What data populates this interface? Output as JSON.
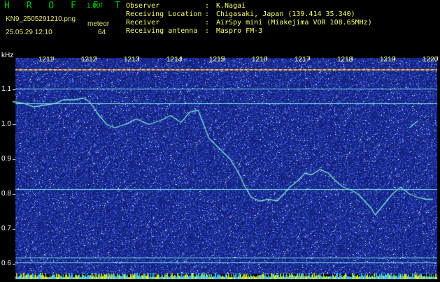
{
  "header": {
    "app_title": "H R O F F T",
    "version": "1.00f",
    "filename": "KN9_2505291210.png",
    "datetime": "25.05.29 12:10",
    "meteor_label": "meteor",
    "meteor_count": "64"
  },
  "info": [
    {
      "label": "Observer",
      "sep": ":",
      "value": "K.Nagai"
    },
    {
      "label": "Receiving Location",
      "sep": ":",
      "value": "Chigasaki, Japan (139.414 35.340)"
    },
    {
      "label": "Receiver",
      "sep": ":",
      "value": "AirSpy mini (Miakejima VOR 108.65MHz)"
    },
    {
      "label": "Receiving antenna",
      "sep": ":",
      "value": "Maspro FM-3"
    }
  ],
  "spectrogram": {
    "y_unit": "kHz",
    "y_ticks": [
      "1.1",
      "1.0",
      "0.9",
      "0.8",
      "0.7",
      "0.6"
    ],
    "y_values": [
      1.1,
      1.0,
      0.9,
      0.8,
      0.7,
      0.6
    ],
    "x_ticks": [
      "1211",
      "1212",
      "1213",
      "1214",
      "1215",
      "1216",
      "1217",
      "1218",
      "1219",
      "1220"
    ],
    "ylim": [
      0.59,
      1.2
    ],
    "horizontal_lines_khz": [
      1.102,
      1.06,
      0.814,
      0.618,
      0.605
    ],
    "colors": {
      "background": "#1a2ea0",
      "noise": "#5a82ff",
      "trace": "#7ee6d2",
      "line": "#78e6e6",
      "top_line": "#c8e650",
      "bottom_bar": "#e6e600"
    }
  }
}
